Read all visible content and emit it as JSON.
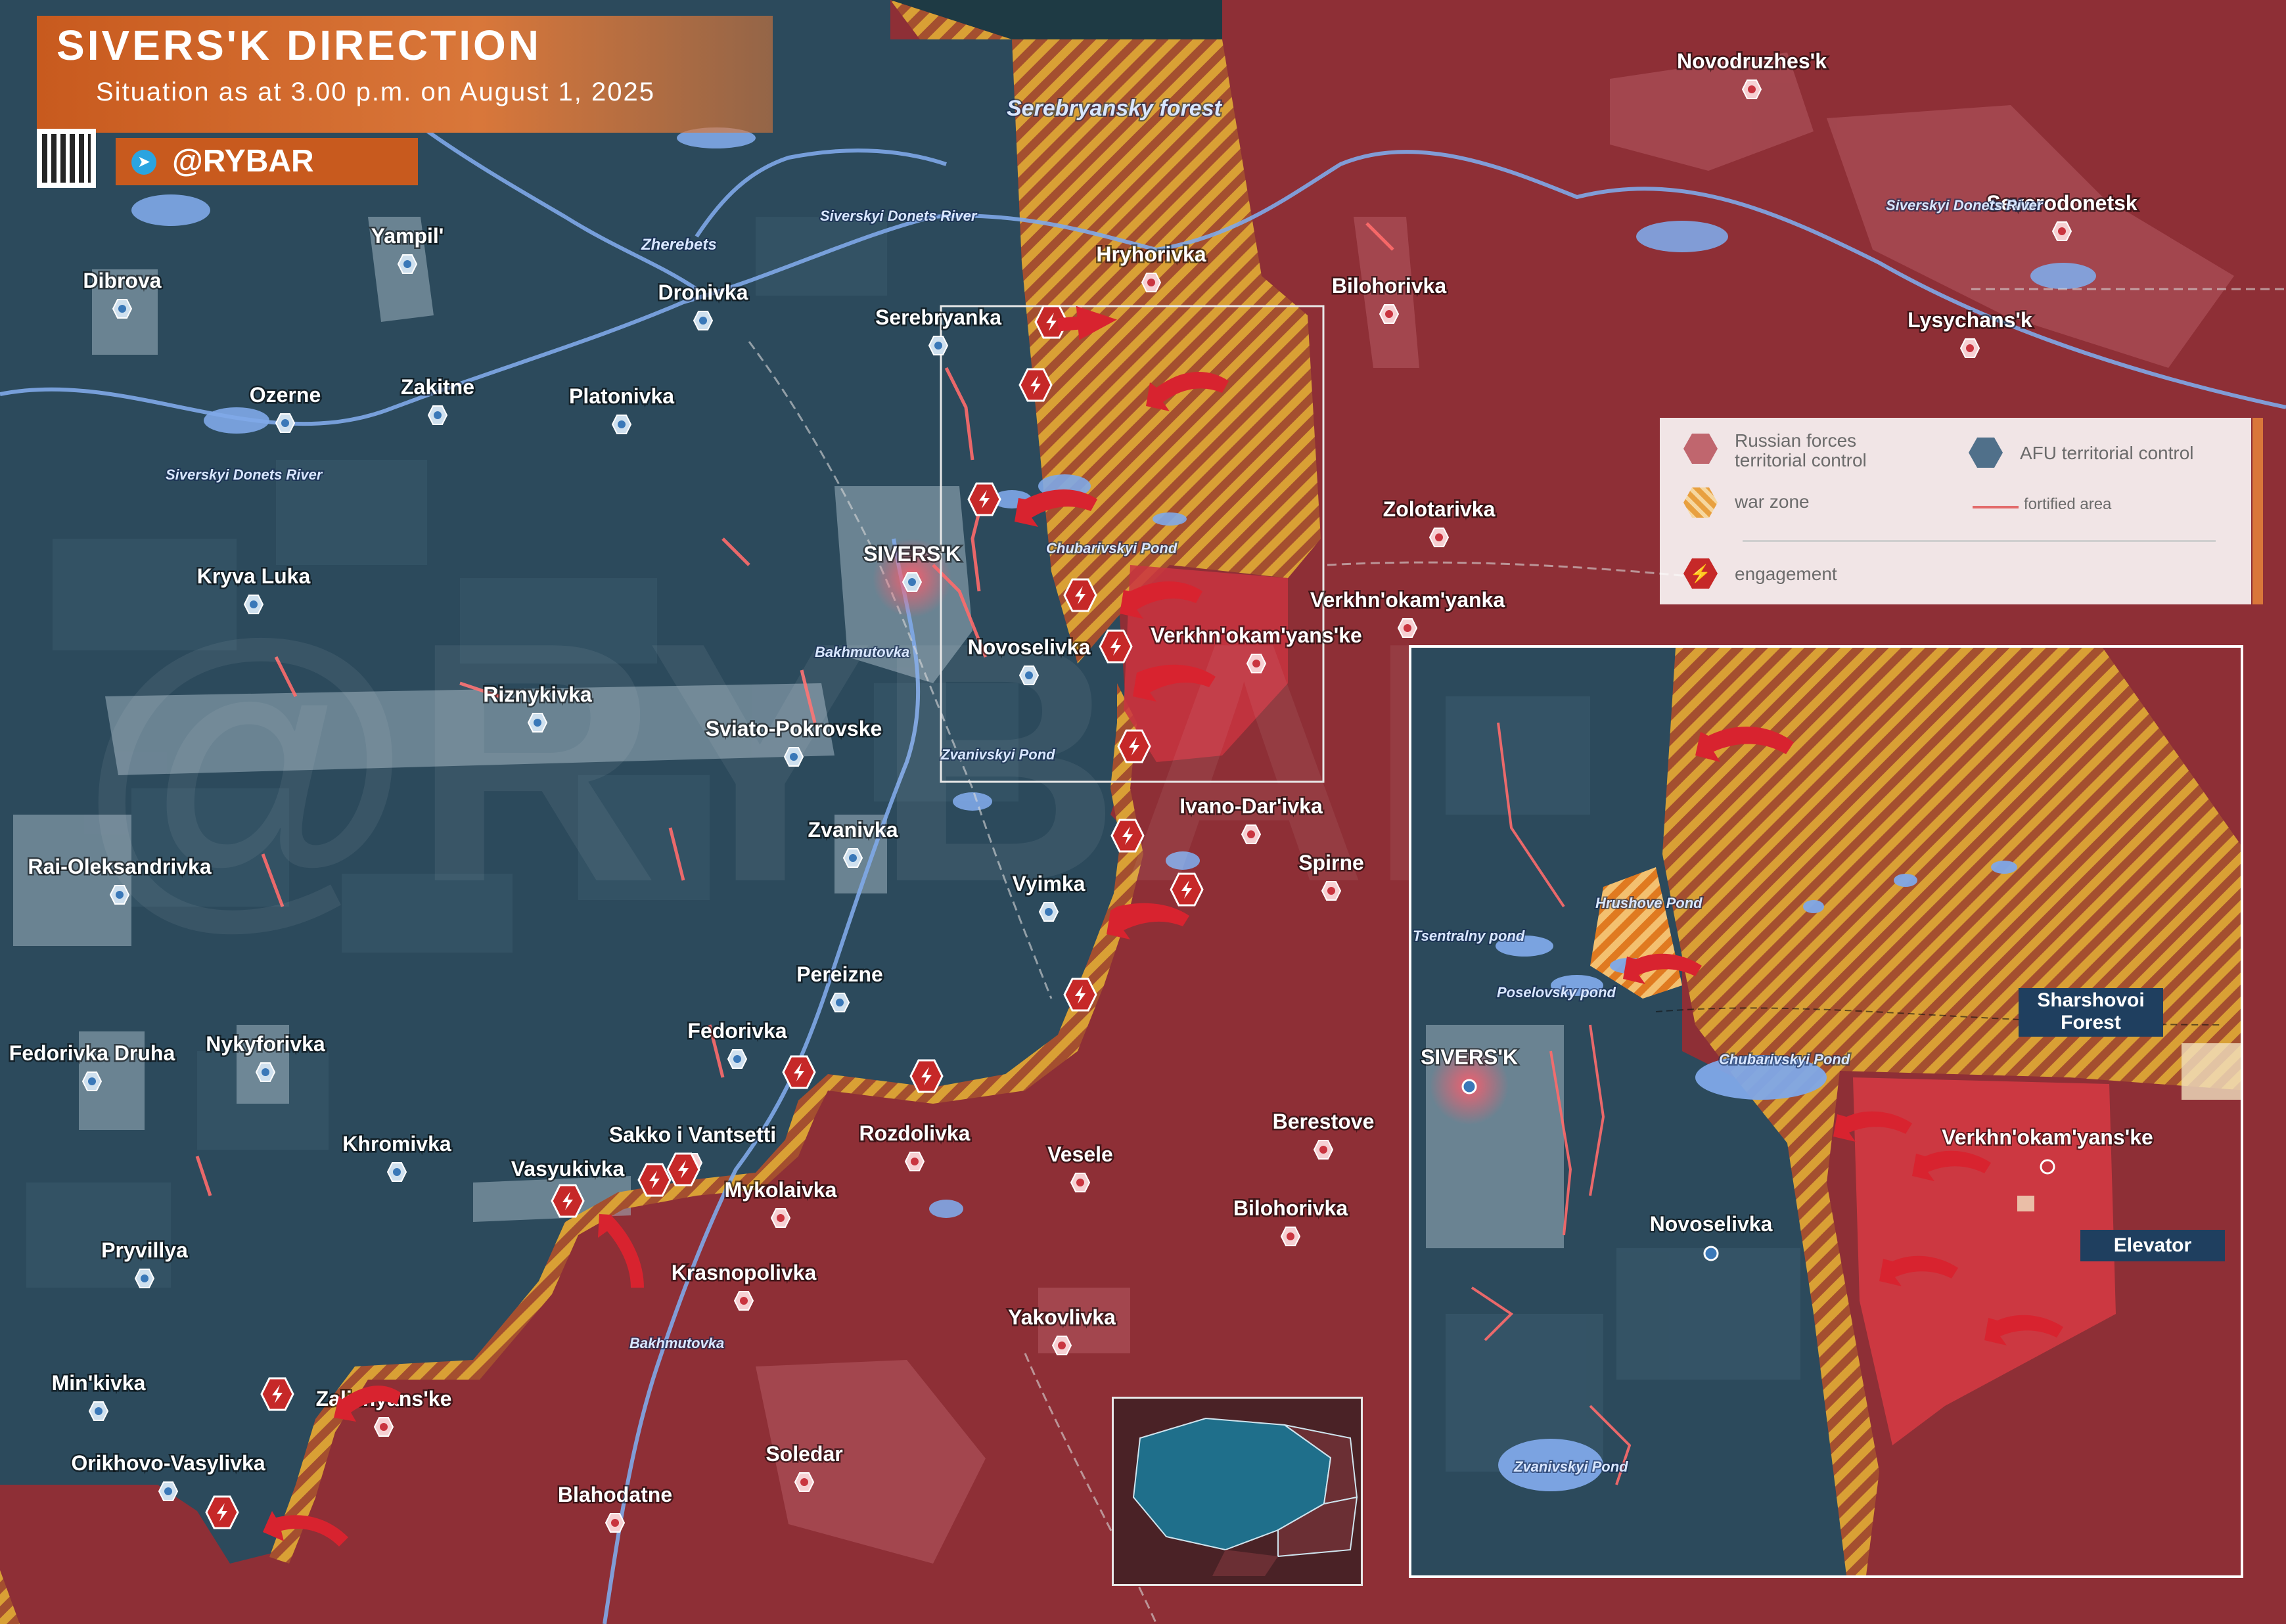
{
  "header": {
    "title": "SIVERS'K DIRECTION",
    "subtitle": "Situation as at 3.00 p.m. on August 1, 2025",
    "handle": "@RYBAR"
  },
  "legend": {
    "russian_control": "Russian forces territorial control",
    "afu_control": "AFU territorial control",
    "war_zone": "war zone",
    "fortified_area": "fortified area",
    "engagement": "engagement"
  },
  "colors": {
    "russian_control": "#8e2f36",
    "afu_control": "#2c4a5c",
    "war_zone": "#d9a035",
    "fortified_line": "#ff6b6b",
    "engagement": "#c62828",
    "title_bar": "#c85a1e",
    "water": "#7fa8e8"
  },
  "settlements": [
    {
      "name": "Novodruzhes'k",
      "side": "ru"
    },
    {
      "name": "Severodonetsk",
      "side": "ru"
    },
    {
      "name": "Lysychans'k",
      "side": "ru"
    },
    {
      "name": "Hryhorivka",
      "side": "ru"
    },
    {
      "name": "Bilohorivka",
      "side": "ru"
    },
    {
      "name": "Serebryanka",
      "side": "ua"
    },
    {
      "name": "Yampil'",
      "side": "ua"
    },
    {
      "name": "Dronivka",
      "side": "ua"
    },
    {
      "name": "Dibrova",
      "side": "ua"
    },
    {
      "name": "Ozerne",
      "side": "ua"
    },
    {
      "name": "Zakitne",
      "side": "ua"
    },
    {
      "name": "Platonivka",
      "side": "ua"
    },
    {
      "name": "Kryva Luka",
      "side": "ua"
    },
    {
      "name": "SIVERS'K",
      "side": "ua"
    },
    {
      "name": "Zolotarivka",
      "side": "ru"
    },
    {
      "name": "Verkhn'okam'yanka",
      "side": "ru"
    },
    {
      "name": "Novoselivka",
      "side": "ua"
    },
    {
      "name": "Verkhn'okam'yans'ke",
      "side": "ru"
    },
    {
      "name": "Riznykivka",
      "side": "ua"
    },
    {
      "name": "Sviato-Pokrovske",
      "side": "ua"
    },
    {
      "name": "Ivano-Dar'ivka",
      "side": "ru"
    },
    {
      "name": "Spirne",
      "side": "ru"
    },
    {
      "name": "Rai-Oleksandrivka",
      "side": "ua"
    },
    {
      "name": "Zvanivka",
      "side": "ua"
    },
    {
      "name": "Vyimka",
      "side": "ua"
    },
    {
      "name": "Pereizne",
      "side": "ua"
    },
    {
      "name": "Fedorivka Druha",
      "side": "ua"
    },
    {
      "name": "Nykyforivka",
      "side": "ua"
    },
    {
      "name": "Fedorivka",
      "side": "ua"
    },
    {
      "name": "Rozdolivka",
      "side": "ru"
    },
    {
      "name": "Vesele",
      "side": "ru"
    },
    {
      "name": "Berestove",
      "side": "ru"
    },
    {
      "name": "Khromivka",
      "side": "ua"
    },
    {
      "name": "Sakko i Vantsetti",
      "side": "ru"
    },
    {
      "name": "Vasyukivka",
      "side": "ua"
    },
    {
      "name": "Mykolaivka",
      "side": "ru"
    },
    {
      "name": "Bilohorivka",
      "side": "ru"
    },
    {
      "name": "Pryvillya",
      "side": "ua"
    },
    {
      "name": "Krasnopolivka",
      "side": "ru"
    },
    {
      "name": "Yakovlivka",
      "side": "ru"
    },
    {
      "name": "Min'kivka",
      "side": "ua"
    },
    {
      "name": "Zaliznyans'ke",
      "side": "ru"
    },
    {
      "name": "Orikhovo-Vasylivka",
      "side": "ua"
    },
    {
      "name": "Soledar",
      "side": "ru"
    },
    {
      "name": "Blahodatne",
      "side": "ru"
    }
  ],
  "water_labels": {
    "serebryansky_forest": "Serebryansky forest",
    "sdr1": "Siverskyi Donets River",
    "sdr2": "Siverskyi Donets River",
    "sdr3": "Siverskyi Donets River",
    "zherebets": "Zherebets",
    "chubarivskyi": "Chubarivskyi Pond",
    "bakhmutovka1": "Bakhmutovka",
    "bakhmutovka2": "Bakhmutovka",
    "zvanivskyi": "Zvanivskyi Pond"
  },
  "inset": {
    "settlements": [
      "SIVERS'K",
      "Novoselivka",
      "Verkhn'okam'yans'ke"
    ],
    "water": {
      "hrushove": "Hrushove Pond",
      "tsentralny": "Tsentralny pond",
      "poselovsky": "Poselovsky pond",
      "chubarivskyi": "Chubarivskyi Pond",
      "zvanivskyi": "Zvanivskyi Pond"
    },
    "callouts": {
      "sharshovoi": "Sharshovoi Forest",
      "elevator": "Elevator"
    }
  },
  "watermark": "@RYBAR"
}
